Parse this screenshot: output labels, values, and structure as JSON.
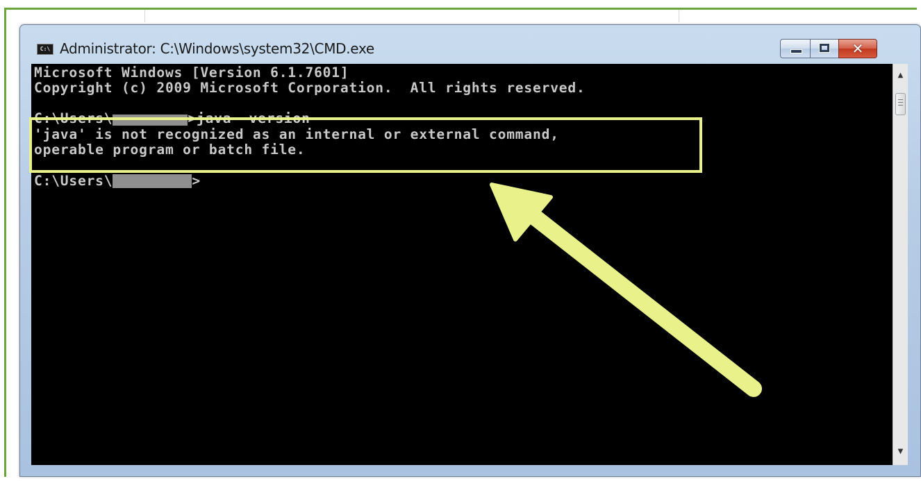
{
  "window": {
    "title": "Administrator: C:\\Windows\\system32\\CMD.exe",
    "icon": "cmd-app-icon",
    "icon_text": "C:\\",
    "controls": {
      "minimize": "minimize-icon",
      "maximize": "maximize-icon",
      "close": "✕"
    }
  },
  "console": {
    "lines": [
      "Microsoft Windows [Version 6.1.7601]",
      "Copyright (c) 2009 Microsoft Corporation.  All rights reserved.",
      "C:\\Users\\",
      ">java -version",
      "'java' is not recognized as an internal or external command,",
      "operable program or batch file.",
      "C:\\Users\\",
      ">"
    ],
    "background": "#000000",
    "text_color": "#c9c9c9"
  },
  "annotation": {
    "highlight_color": "#e9f28a",
    "arrow_color": "#e9f28a"
  },
  "frame": {
    "border_color": "#6aa43a"
  }
}
